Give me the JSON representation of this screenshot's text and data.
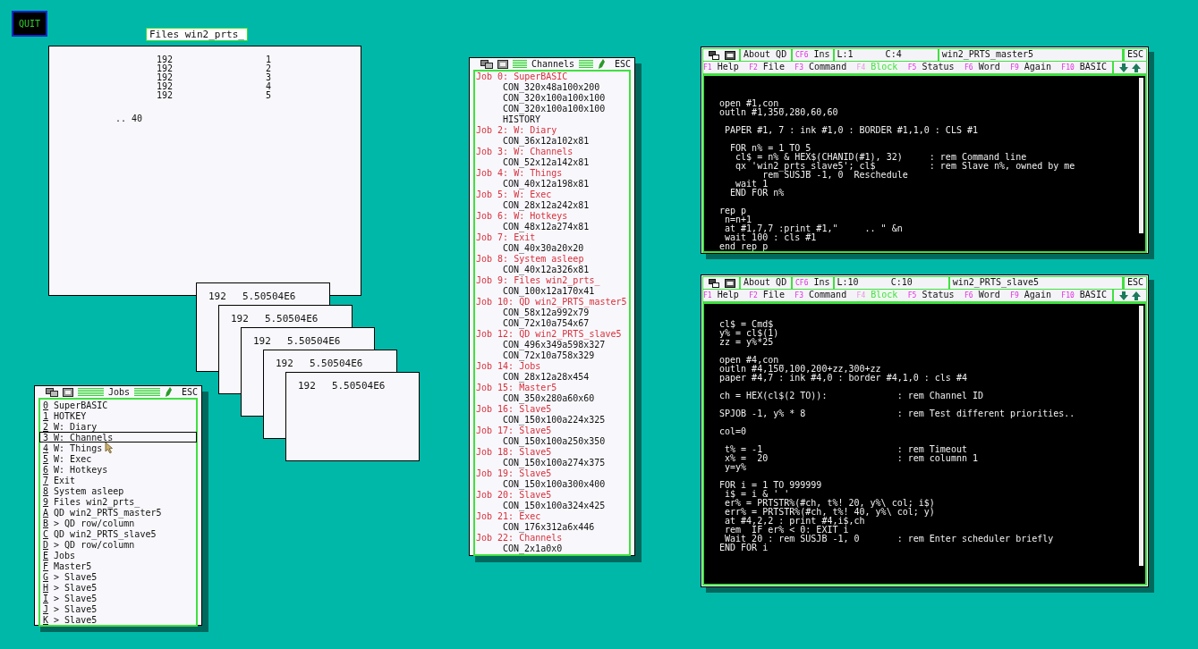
{
  "quit_button": "QUIT",
  "files_window": {
    "title": "Files win2_prts_",
    "rows": [
      {
        "column_1": "192",
        "column_2": "1"
      },
      {
        "column_1": "192",
        "column_2": "2"
      },
      {
        "column_1": "192",
        "column_2": "3"
      },
      {
        "column_1": "192",
        "column_2": "4"
      },
      {
        "column_1": "192",
        "column_2": "5"
      }
    ],
    "footer": ".. 40"
  },
  "slave_windows": [
    {
      "number": "192",
      "value": "5.50504E6"
    },
    {
      "number": "192",
      "value": "5.50504E6"
    },
    {
      "number": "192",
      "value": "5.50504E6"
    },
    {
      "number": "192",
      "value": "5.50504E6"
    },
    {
      "number": "192",
      "value": "5.50504E6"
    }
  ],
  "jobs_window": {
    "title": "Jobs",
    "escape": "ESC",
    "items": [
      {
        "key": "0",
        "label": "SuperBASIC",
        "selected": false
      },
      {
        "key": "1",
        "label": "HOTKEY",
        "selected": false
      },
      {
        "key": "2",
        "label": "W: Diary",
        "selected": false
      },
      {
        "key": "3",
        "label": "W: Channels",
        "selected": true
      },
      {
        "key": "4",
        "label": "W: Things",
        "selected": false
      },
      {
        "key": "5",
        "label": "W: Exec",
        "selected": false
      },
      {
        "key": "6",
        "label": "W: Hotkeys",
        "selected": false
      },
      {
        "key": "7",
        "label": "Exit",
        "selected": false
      },
      {
        "key": "8",
        "label": "System asleep",
        "selected": false
      },
      {
        "key": "9",
        "label": "Files win2_prts_",
        "selected": false
      },
      {
        "key": "A",
        "label": "QD win2_PRTS_master5",
        "selected": false
      },
      {
        "key": "B",
        "label": "> QD row/column",
        "selected": false
      },
      {
        "key": "C",
        "label": "QD win2_PRTS_slave5",
        "selected": false
      },
      {
        "key": "D",
        "label": "> QD row/column",
        "selected": false
      },
      {
        "key": "E",
        "label": "Jobs",
        "selected": false
      },
      {
        "key": "F",
        "label": "Master5",
        "selected": false
      },
      {
        "key": "G",
        "label": "> Slave5",
        "selected": false
      },
      {
        "key": "H",
        "label": "> Slave5",
        "selected": false
      },
      {
        "key": "I",
        "label": "> Slave5",
        "selected": false
      },
      {
        "key": "J",
        "label": "> Slave5",
        "selected": false
      },
      {
        "key": "K",
        "label": "> Slave5",
        "selected": false
      }
    ]
  },
  "channels_window": {
    "title": "Channels",
    "escape": "ESC",
    "jobs": [
      {
        "job": "Job 0: SuperBASIC",
        "channels": [
          "CON_320x48a100x200",
          "CON_320x100a100x100",
          "CON_320x100a100x100",
          "HISTORY"
        ]
      },
      {
        "job": "Job 2: W: Diary",
        "channels": [
          "CON_36x12a102x81"
        ]
      },
      {
        "job": "Job 3: W: Channels",
        "channels": [
          "CON_52x12a142x81"
        ]
      },
      {
        "job": "Job 4: W: Things",
        "channels": [
          "CON_40x12a198x81"
        ]
      },
      {
        "job": "Job 5: W: Exec",
        "channels": [
          "CON_28x12a242x81"
        ]
      },
      {
        "job": "Job 6: W: Hotkeys",
        "channels": [
          "CON_48x12a274x81"
        ]
      },
      {
        "job": "Job 7: Exit",
        "channels": [
          "CON_40x30a20x20"
        ]
      },
      {
        "job": "Job 8: System asleep",
        "channels": [
          "CON_40x12a326x81"
        ]
      },
      {
        "job": "Job 9: Files win2_prts_",
        "channels": [
          "CON_100x12a170x41"
        ]
      },
      {
        "job": "Job 10: QD win2_PRTS_master5",
        "channels": [
          "CON_58x12a992x79",
          "CON_72x10a754x67"
        ]
      },
      {
        "job": "Job 12: QD win2_PRTS_slave5",
        "channels": [
          "CON_496x349a598x327",
          "CON_72x10a758x329"
        ]
      },
      {
        "job": "Job 14: Jobs",
        "channels": [
          "CON_28x12a28x454"
        ]
      },
      {
        "job": "Job 15: Master5",
        "channels": [
          "CON_350x280a60x60"
        ]
      },
      {
        "job": "Job 16: Slave5",
        "channels": [
          "CON_150x100a224x325"
        ]
      },
      {
        "job": "Job 17: Slave5",
        "channels": [
          "CON_150x100a250x350"
        ]
      },
      {
        "job": "Job 18: Slave5",
        "channels": [
          "CON_150x100a274x375"
        ]
      },
      {
        "job": "Job 19: Slave5",
        "channels": [
          "CON_150x100a300x400"
        ]
      },
      {
        "job": "Job 20: Slave5",
        "channels": [
          "CON_150x100a324x425"
        ]
      },
      {
        "job": "Job 21: Exec",
        "channels": [
          "CON_176x312a6x446"
        ]
      },
      {
        "job": "Job 22: Channels",
        "channels": [
          "CON_2x1a0x0"
        ]
      }
    ]
  },
  "editors": [
    {
      "about": "About QD",
      "mode_key": "CF6",
      "mode": "Ins",
      "line": "L:1",
      "column": "C:4",
      "title": "win2_PRTS_master5",
      "escape": "ESC",
      "function_keys": [
        {
          "key": "F1",
          "label": "Help",
          "disabled": false
        },
        {
          "key": "F2",
          "label": "File",
          "disabled": false
        },
        {
          "key": "F3",
          "label": "Command",
          "disabled": false
        },
        {
          "key": "F4",
          "label": "Block",
          "disabled": true
        },
        {
          "key": "F5",
          "label": "Status",
          "disabled": false
        },
        {
          "key": "F6",
          "label": "Word",
          "disabled": false
        },
        {
          "key": "F9",
          "label": "Again",
          "disabled": false
        },
        {
          "key": "F10",
          "label": "BASIC",
          "disabled": false
        }
      ],
      "code": [
        [
          "open #1,con_",
          "outln #1,350,280,60,60"
        ],
        [
          " PAPER #1, 7 : ink #1,0 : BORDER #1,1,0 : CLS #1"
        ],
        [
          "  FOR n% = 1 TO 5",
          "   cl$ = n% & HEX$(CHANID(#1), 32)     : rem Command line",
          "   qx 'win2_prts_slave5'; cl$          : rem Slave n%, owned by me",
          "        rem SUSJB -1, 0  Reschedule",
          "   wait 1",
          "  END FOR n%"
        ],
        [
          "rep p",
          " n=n+1",
          " at #1,7,7 :print #1,\"     .. \" &n",
          " wait 100 : cls #1",
          "end rep p"
        ]
      ]
    },
    {
      "about": "About QD",
      "mode_key": "CF6",
      "mode": "Ins",
      "line": "L:10",
      "column": "C:10",
      "title": "win2_PRTS_slave5",
      "escape": "ESC",
      "function_keys": [
        {
          "key": "F1",
          "label": "Help",
          "disabled": false
        },
        {
          "key": "F2",
          "label": "File",
          "disabled": false
        },
        {
          "key": "F3",
          "label": "Command",
          "disabled": false
        },
        {
          "key": "F4",
          "label": "Block",
          "disabled": true
        },
        {
          "key": "F5",
          "label": "Status",
          "disabled": false
        },
        {
          "key": "F6",
          "label": "Word",
          "disabled": false
        },
        {
          "key": "F9",
          "label": "Again",
          "disabled": false
        },
        {
          "key": "F10",
          "label": "BASIC",
          "disabled": false
        }
      ],
      "code": [
        [
          "cl$ = Cmd$",
          "y% = cl$(1)",
          "zz = y%*25"
        ],
        [
          "open #4,con_",
          "outln #4,150,100,200+zz,300+zz",
          "paper #4,7 : ink #4,0 : border #4,1,0 : cls #4"
        ],
        [
          "ch = HEX(cl$(2 TO)):             : rem Channel ID"
        ],
        [
          "SPJOB -1, y% * 8                 : rem Test different priorities.."
        ],
        [
          "col=0"
        ],
        [
          " t% = -1                         : rem Timeout",
          " x% =  20                        : rem columnn 1",
          " y=y%"
        ],
        [
          "FOR i = 1 TO 999999",
          " i$ = i & ' '",
          " er% = PRTSTR%(#ch, t%! 20, y%\\ col; i$)",
          " err% = PRTSTR%(#ch, t%! 40, y%\\ col; y)",
          " at #4,2,2 : print #4,i$,ch",
          " rem  IF er% < 0: EXIT i",
          " Wait 20 : rem SUSJB -1, 0       : rem Enter scheduler briefly",
          "END FOR i"
        ]
      ]
    }
  ]
}
